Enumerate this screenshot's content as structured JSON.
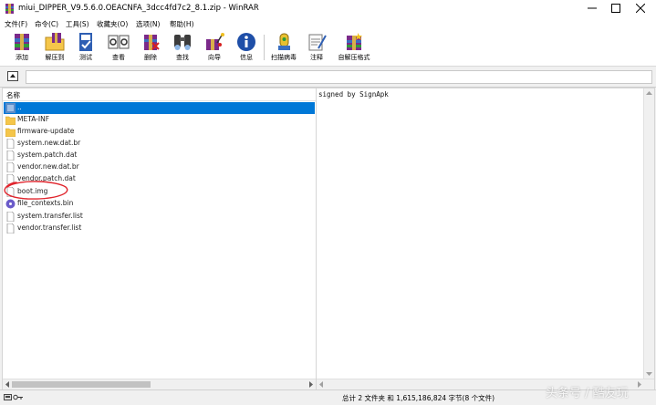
{
  "window": {
    "title": "miui_DIPPER_V9.5.6.0.OEACNFA_3dcc4fd7c2_8.1.zip - WinRAR"
  },
  "menu": {
    "items": [
      {
        "label": "文件(F)"
      },
      {
        "label": "命令(C)"
      },
      {
        "label": "工具(S)"
      },
      {
        "label": "收藏夹(O)"
      },
      {
        "label": "选项(N)"
      },
      {
        "label": "帮助(H)"
      }
    ]
  },
  "toolbar": {
    "buttons": [
      {
        "label": "添加",
        "icon": "add-archive-icon"
      },
      {
        "label": "解压到",
        "icon": "extract-to-icon"
      },
      {
        "label": "测试",
        "icon": "test-icon"
      },
      {
        "label": "查看",
        "icon": "view-icon"
      },
      {
        "label": "删除",
        "icon": "delete-icon"
      },
      {
        "label": "查找",
        "icon": "find-icon"
      },
      {
        "label": "向导",
        "icon": "wizard-icon"
      },
      {
        "label": "信息",
        "icon": "info-icon"
      },
      {
        "label": "扫描病毒",
        "icon": "virus-scan-icon"
      },
      {
        "label": "注释",
        "icon": "comment-icon"
      },
      {
        "label": "自解压格式",
        "icon": "sfx-icon"
      }
    ]
  },
  "filelist": {
    "column_name": "名称",
    "rows": [
      {
        "name": "..",
        "type": "parent",
        "selected": true
      },
      {
        "name": "META-INF",
        "type": "folder"
      },
      {
        "name": "firmware-update",
        "type": "folder"
      },
      {
        "name": "system.new.dat.br",
        "type": "file"
      },
      {
        "name": "system.patch.dat",
        "type": "file"
      },
      {
        "name": "vendor.new.dat.br",
        "type": "file"
      },
      {
        "name": "vendor.patch.dat",
        "type": "file"
      },
      {
        "name": "boot.img",
        "type": "file"
      },
      {
        "name": "file_contexts.bin",
        "type": "bin"
      },
      {
        "name": "system.transfer.list",
        "type": "file"
      },
      {
        "name": "vendor.transfer.list",
        "type": "file"
      }
    ]
  },
  "comment": {
    "text": "signed by SignApk"
  },
  "status": {
    "text": "总计 2 文件夹 和 1,615,186,824 字节(8 个文件)"
  },
  "watermark": {
    "text": "头条号 / 酷友玩"
  },
  "colors": {
    "selection": "#0078d7",
    "annotation": "#e0242c",
    "folder": "#f5c64a"
  }
}
